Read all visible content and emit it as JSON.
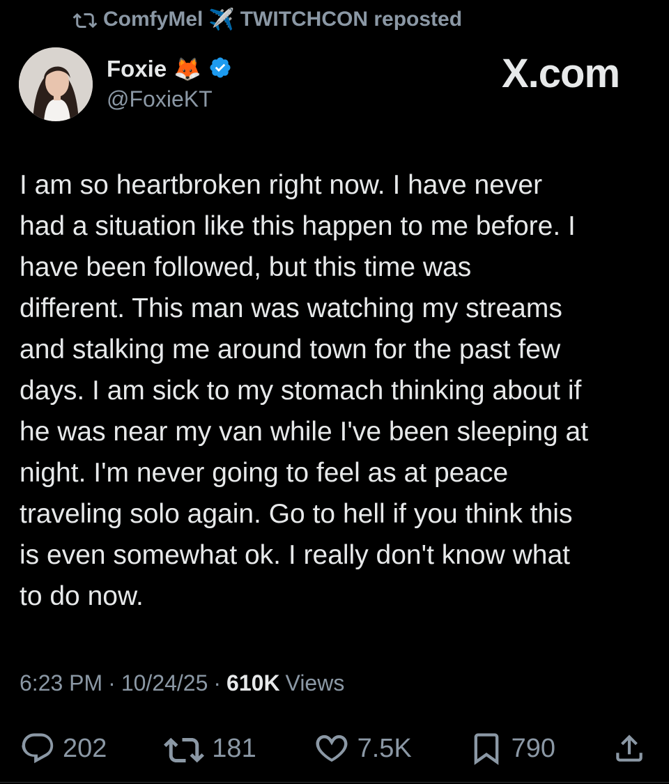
{
  "repost": {
    "reposter": "ComfyMel",
    "reposter_emoji": "✈️",
    "reposter_suffix": "TWITCHCON reposted",
    "icon": "repost-icon"
  },
  "author": {
    "display_name": "Foxie",
    "emoji": "🦊",
    "verified": true,
    "handle": "@FoxieKT"
  },
  "source_logo": "X.com",
  "tweet": {
    "text": "I am so heartbroken right now. I have never\nhad a situation like this happen to me before. I\nhave been followed, but this time was\ndifferent. This man was watching my streams\nand stalking me around town for the past few\ndays. I am sick to my stomach thinking about if\nhe was near my van while I've been sleeping at\nnight. I'm never going to feel as at peace\ntraveling solo again. Go to hell if you think this\nis even somewhat ok. I really don't know what\nto do now."
  },
  "meta": {
    "time": "6:23 PM",
    "separator": "·",
    "date": "10/24/25",
    "views_count": "610K",
    "views_label": "Views"
  },
  "actions": {
    "replies": "202",
    "reposts": "181",
    "likes": "7.5K",
    "bookmarks": "790"
  },
  "colors": {
    "background": "#000000",
    "text": "#e7e9ea",
    "muted": "#8b98a5",
    "verified": "#1d9bf0"
  }
}
